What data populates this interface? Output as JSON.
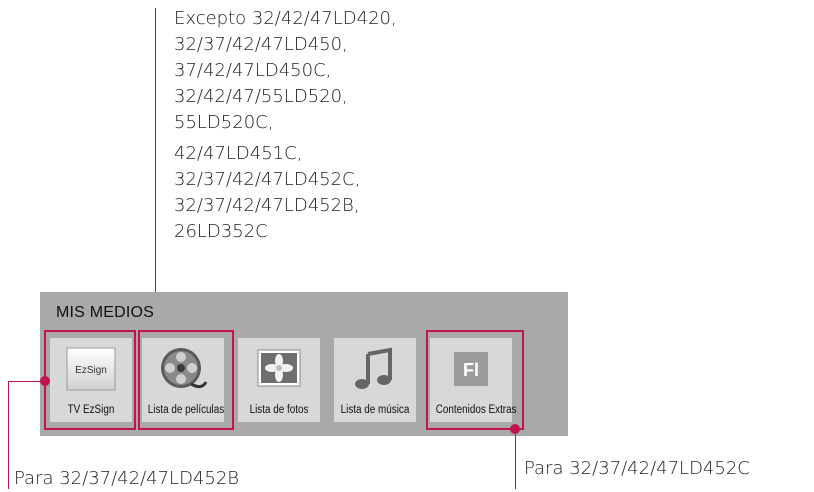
{
  "notes": {
    "top_lines_1": [
      "Excepto 32/42/47LD420,",
      "32/37/42/47LD450,",
      "37/42/47LD450C,",
      "32/42/47/55LD520,",
      "55LD520C,"
    ],
    "top_lines_2": [
      "42/47LD451C,",
      "32/37/42/47LD452C,",
      "32/37/42/47LD452B,",
      "26LD352C"
    ],
    "bottom_left": "Para 32/37/42/47LD452B",
    "bottom_right": "Para 32/37/42/47LD452C"
  },
  "menu": {
    "title": "MIS MEDIOS",
    "items": [
      {
        "label": "TV EzSign",
        "icon": "ezsign-icon",
        "icon_text": "EzSign"
      },
      {
        "label": "Lista de películas",
        "icon": "film-reel-icon"
      },
      {
        "label": "Lista de fotos",
        "icon": "photo-icon"
      },
      {
        "label": "Lista de música",
        "icon": "music-note-icon"
      },
      {
        "label": "Contenidos Extras",
        "icon": "flash-icon",
        "icon_text": "Fl"
      }
    ]
  },
  "colors": {
    "accent": "#c0134f",
    "panel": "#a9a9a9",
    "tile": "#d8d8d8"
  }
}
